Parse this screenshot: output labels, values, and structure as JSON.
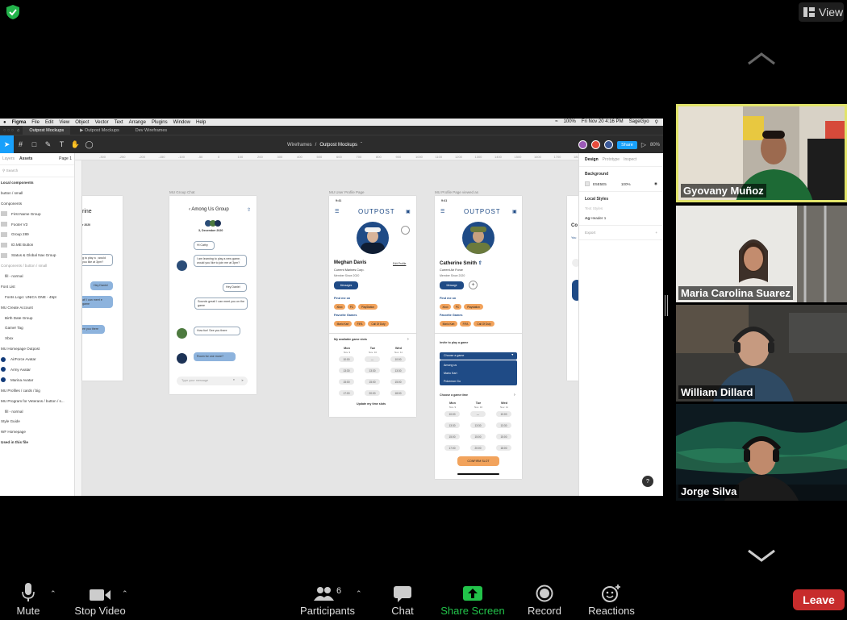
{
  "zoom": {
    "view_label": "View",
    "participants_count": "6"
  },
  "mac_menu": {
    "app": "Figma",
    "items": [
      "File",
      "Edit",
      "View",
      "Object",
      "Vector",
      "Text",
      "Arrange",
      "Plugins",
      "Window",
      "Help"
    ],
    "battery": "100%",
    "clock": "Fri Nov 20  4:16 PM",
    "user": "SageGyo"
  },
  "figma": {
    "tabs": [
      "Outpost Mockups",
      "Outpost Mockups",
      "Dev Wireframes"
    ],
    "breadcrumb_parent": "Wireframes",
    "breadcrumb_sep": "/",
    "file_name": "Outpost Mockups",
    "share_label": "Share",
    "zoom_level": "80%",
    "ruler_marks": [
      "-300",
      "-250",
      "-200",
      "-150",
      "-100",
      "-50",
      "0",
      "100",
      "200",
      "300",
      "400",
      "500",
      "600",
      "700",
      "800",
      "900",
      "1000",
      "1100",
      "1200",
      "1300",
      "1400",
      "1500",
      "1600",
      "1700",
      "1800"
    ],
    "left_panel": {
      "tab_layers": "Layers",
      "tab_assets": "Assets",
      "page": "Page 1",
      "search_placeholder": "Search",
      "rows": [
        {
          "text": "Local components",
          "kind": "sec"
        },
        {
          "text": "button / small",
          "kind": "plain"
        },
        {
          "text": "Components",
          "kind": "plain"
        },
        {
          "text": "First Name Group",
          "kind": "thumb"
        },
        {
          "text": "Footer V3",
          "kind": "thumb"
        },
        {
          "text": "Group 289",
          "kind": "thumb"
        },
        {
          "text": "ID.ME Button",
          "kind": "thumb"
        },
        {
          "text": "Status & Global Nav Group",
          "kind": "thumb"
        },
        {
          "text": "Components / button / small",
          "kind": "dim"
        },
        {
          "text": "fill - normal",
          "kind": "ind"
        },
        {
          "text": "Font List",
          "kind": "plain"
        },
        {
          "text": "Fonts Logo: UNICA ONE - 45pt",
          "kind": "ind"
        },
        {
          "text": "MU Create Account",
          "kind": "plain"
        },
        {
          "text": "Birth Date Group",
          "kind": "ind"
        },
        {
          "text": "Gamer Tag",
          "kind": "ind"
        },
        {
          "text": "Xbox",
          "kind": "ind"
        },
        {
          "text": "MU Homepage Outpost",
          "kind": "plain"
        },
        {
          "text": "AirForce Avatar",
          "kind": "dot"
        },
        {
          "text": "Army Avatar",
          "kind": "dot"
        },
        {
          "text": "Marina Avatar",
          "kind": "dot"
        },
        {
          "text": "MU Profiles / cards / big",
          "kind": "plain"
        },
        {
          "text": "MU Program for Veterans / button / s...",
          "kind": "plain"
        },
        {
          "text": "fill - normal",
          "kind": "ind"
        },
        {
          "text": "Style Guide",
          "kind": "plain"
        },
        {
          "text": "WF Homepage",
          "kind": "plain"
        },
        {
          "text": "Used in this file",
          "kind": "sec"
        }
      ]
    },
    "right_panel": {
      "tab_design": "Design",
      "tab_prototype": "Prototype",
      "tab_inspect": "Inspect",
      "background_title": "Background",
      "bg_hex": "E5E5E5",
      "bg_opacity": "100%",
      "local_styles_title": "Local Styles",
      "text_styles": "Text Styles",
      "header_style": "Header 1",
      "export_title": "Export"
    },
    "frames": {
      "group_chat": {
        "label": "MU Group Chat",
        "title": "Among Us Group",
        "date": "3, December 2020",
        "messages": [
          {
            "text": "Hi Cathy",
            "mine": false
          },
          {
            "text": "I am learning to play a new game, would you like to join me at 3pm?",
            "mine": false
          },
          {
            "text": "Hey Daniel",
            "mine": false
          },
          {
            "text": "Sounds great! I can meet you on the game",
            "mine": false
          },
          {
            "text": "How fun! See you there",
            "mine": false
          },
          {
            "text": "Room for one more?",
            "mine": true
          }
        ],
        "input_placeholder": "Type your message"
      },
      "partial": {
        "title_fragment": "rine",
        "date_fragment": "r 2020",
        "msg1": "g to play a , would you like at 3pm?",
        "msg2": "Hey Daniel",
        "msg3": "at! I can meet e game",
        "msg4": "ee you there"
      },
      "user_profile": {
        "label": "MU User Profile Page",
        "time": "9:41",
        "logo": "OUTPOST",
        "name": "Meghan Davis",
        "edit": "Edit Profile",
        "branch": "Current Marines Corp.",
        "since": "Member Since 2020",
        "message_btn": "Messages",
        "find_me_on": "Find me on",
        "platforms": [
          "Xbox",
          "PC",
          "PlayStation"
        ],
        "fav_games": "Favorite Games",
        "games": [
          "Mario Kart",
          "FIFA",
          "Call Of Duty"
        ],
        "slots_title": "My available game slots",
        "days": [
          {
            "name": "Mon",
            "date": "Nov. 9"
          },
          {
            "name": "Tue",
            "date": "Nov. 10"
          },
          {
            "name": "Wed",
            "date": "Nov. 11"
          }
        ],
        "slots": [
          [
            "10:00",
            "—",
            "10:00"
          ],
          [
            "13:30",
            "13:30",
            "13:30"
          ],
          [
            "15:00",
            "15:00",
            "15:00"
          ],
          [
            "17:00",
            "20:00",
            "18:00"
          ]
        ],
        "update_link": "Update my time slots"
      },
      "viewed_profile": {
        "label": "MU Profile Page viewed as",
        "time": "9:41",
        "logo": "OUTPOST",
        "name": "Catherine Smith",
        "branch": "Current Air Force",
        "since": "Member Since 2020",
        "message_btn": "Message",
        "find_me_on": "Find me on",
        "platforms": [
          "Xbox",
          "PC",
          "Playstation"
        ],
        "fav_games": "Favorite Games",
        "games": [
          "Mario Kart",
          "FIFA",
          "Call Of Duty"
        ],
        "invite_title": "Invite to play a game",
        "choose_game": "Choose a game",
        "game_options": [
          "Among us",
          "Mario Kart",
          "Pokemon Go"
        ],
        "choose_time": "Choose a game time",
        "days": [
          {
            "name": "Mon",
            "date": "Nov. 9"
          },
          {
            "name": "Tue",
            "date": "Nov. 10"
          },
          {
            "name": "Wed",
            "date": "Nov. 11"
          }
        ],
        "slots": [
          [
            "10:00",
            "—",
            "10:00"
          ],
          [
            "13:30",
            "13:30",
            "13:30"
          ],
          [
            "15:00",
            "15:00",
            "15:00"
          ],
          [
            "17:00",
            "20:00",
            "18:00"
          ]
        ],
        "confirm_btn": "CONFIRM SLOT"
      },
      "edge": {
        "letters": "Co",
        "word": "You"
      }
    }
  },
  "participants": [
    {
      "name": "Gyovany Muñoz",
      "active": true
    },
    {
      "name": "Maria Carolina Suarez",
      "active": false
    },
    {
      "name": "William Dillard",
      "active": false
    },
    {
      "name": "Jorge Silva",
      "active": false
    }
  ],
  "toolbar": {
    "mute": "Mute",
    "stop_video": "Stop Video",
    "participants": "Participants",
    "chat": "Chat",
    "share_screen": "Share Screen",
    "record": "Record",
    "reactions": "Reactions",
    "leave": "Leave"
  },
  "colors": {
    "share_green": "#22c34a",
    "leave_red": "#c72c2c",
    "active_speaker": "#e1e36a",
    "figma_blue": "#18a0fb",
    "outpost_navy": "#1f4b86",
    "outpost_orange": "#f2a35c"
  }
}
